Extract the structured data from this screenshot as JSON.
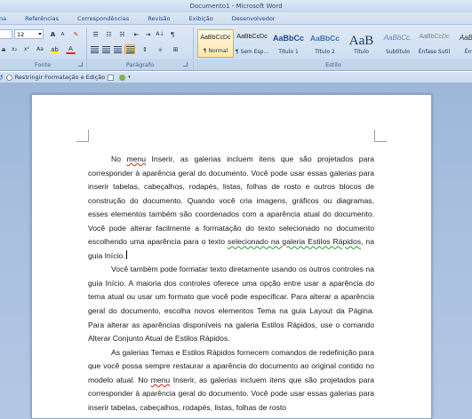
{
  "window": {
    "title": "Documento1 - Microsoft Word"
  },
  "ribbon_tabs": [
    "na",
    "Referências",
    "Correspondências",
    "Revisão",
    "Exibição",
    "Desenvolvedor"
  ],
  "font_group": {
    "font_name": "",
    "font_size": "12",
    "grow_font": "A",
    "shrink_font": "A",
    "label": "Fonte"
  },
  "paragraph_group": {
    "label": "Parágrafo"
  },
  "styles_group": {
    "label": "Estilo",
    "styles": [
      {
        "preview": "AaBbCcDc",
        "name": "¶ Normal",
        "selected": true
      },
      {
        "preview": "AaBbCcDc",
        "name": "¶ Sem Esp...",
        "selected": false
      },
      {
        "preview": "AaBbCc",
        "name": "Título 1",
        "selected": false
      },
      {
        "preview": "AaBbCc",
        "name": "Título 2",
        "selected": false
      },
      {
        "preview": "AaB",
        "name": "Título",
        "selected": false
      },
      {
        "preview": "AaBbCc.",
        "name": "Subtítulo",
        "selected": false
      },
      {
        "preview": "AaBbCcDc",
        "name": "Ênfase Sutil",
        "selected": false
      },
      {
        "preview": "AaBbC",
        "name": "Ênfa",
        "selected": false
      }
    ]
  },
  "quick_access": {
    "restrict_label": "Restringir Formatação e Edição"
  },
  "document": {
    "p1_a": "No ",
    "p1_menu": "menu",
    "p1_b": " Inserir, as galerias incluem itens que são projetados para corresponder à aparência geral do documento. Você pode usar essas galerias para inserir tabelas, cabeçalhos, rodapés, listas, folhas de rosto e outros blocos de construção do documento. Quando você cria imagens, gráficos ou diagramas, esses elementos também são coordenados com a aparência atual do documento. Você pode alterar facilmente a formatação do texto selecionado no documento escolhendo uma aparência para o texto ",
    "p1_green": "selecionado na galeria Estilos Rápidos",
    "p1_c": ", na guia Início.",
    "p2": "Você também pode formatar texto diretamente usando os outros controles na guia Início. A maioria dos controles oferece uma opção entre usar a aparência do tema atual ou usar um formato que você pode especificar. Para alterar a aparência geral do documento, escolha novos elementos Tema na guia Layout da Página. Para alterar as aparências disponíveis na galeria Estilos Rápidos, use o comando Alterar Conjunto Atual de Estilos Rápidos.",
    "p3_a": "As galerias Temas e Estilos Rápidos fornecem comandos de redefinição para que você possa sempre restaurar a aparência do documento ao original contido no modelo atual. No ",
    "p3_menu": "menu",
    "p3_b": " Inserir, as galerias incluem itens que são projetados para corresponder à aparência geral do documento. Você pode usar essas galerias para inserir tabelas, cabeçalhos, rodapés, listas, folhas de rosto"
  }
}
